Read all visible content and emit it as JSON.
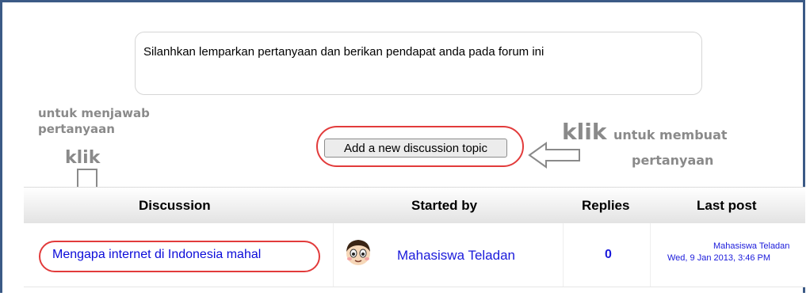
{
  "intro": {
    "text": "Silanhkan lemparkan pertanyaan dan berikan pendapat anda pada forum ini"
  },
  "annotations": {
    "left_line1": "untuk menjawab",
    "left_line2": "pertanyaan",
    "left_klik": "klik",
    "right_klik": "klik",
    "right_line1": "untuk membuat",
    "right_line2": "pertanyaan"
  },
  "toolbar": {
    "add_topic_label": "Add a new discussion topic"
  },
  "table": {
    "headers": {
      "discussion": "Discussion",
      "started_by": "Started by",
      "replies": "Replies",
      "last_post": "Last post"
    },
    "rows": [
      {
        "topic": "Mengapa internet di Indonesia mahal",
        "author": "Mahasiswa Teladan",
        "replies": "0",
        "last_post_author": "Mahasiswa Teladan",
        "last_post_date": "Wed, 9 Jan 2013, 3:46 PM"
      }
    ]
  },
  "colors": {
    "frame_border": "#3b5a86",
    "highlight_red": "#e23b3b",
    "link_blue": "#1a1adb",
    "annotation_gray": "#8a8a8a"
  },
  "icons": {
    "avatar": "smiling-cartoon-face-avatar",
    "arrow_down": "hollow-down-arrow-icon",
    "arrow_left": "hollow-left-arrow-icon"
  }
}
